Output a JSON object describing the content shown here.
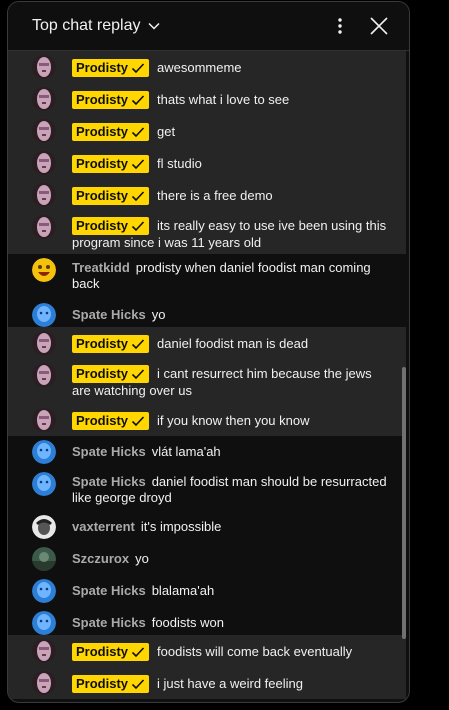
{
  "header": {
    "title": "Top chat replay",
    "menu_icon": "more-vert-icon",
    "close_icon": "close-icon"
  },
  "colors": {
    "background": "#0f0f0f",
    "highlight_row": "#262626",
    "owner_badge": "#ffd600",
    "author_name": "#aaaaaa",
    "message_text": "#f1f1f1"
  },
  "messages": [
    {
      "author": "Prodisty",
      "owner": true,
      "text": "awesommeme"
    },
    {
      "author": "Prodisty",
      "owner": true,
      "text": "thats what i love to see"
    },
    {
      "author": "Prodisty",
      "owner": true,
      "text": "get"
    },
    {
      "author": "Prodisty",
      "owner": true,
      "text": "fl studio"
    },
    {
      "author": "Prodisty",
      "owner": true,
      "text": "there is a free demo"
    },
    {
      "author": "Prodisty",
      "owner": true,
      "text": "its really easy to use ive been using this program since i was 11 years old"
    },
    {
      "author": "Treatkidd",
      "owner": false,
      "text": "prodisty when daniel foodist man coming back"
    },
    {
      "author": "Spate Hicks",
      "owner": false,
      "text": "yo"
    },
    {
      "author": "Prodisty",
      "owner": true,
      "text": "daniel foodist man is dead"
    },
    {
      "author": "Prodisty",
      "owner": true,
      "text": "i cant resurrect him because the jews are watching over us"
    },
    {
      "author": "Prodisty",
      "owner": true,
      "text": "if you know then you know"
    },
    {
      "author": "Spate Hicks",
      "owner": false,
      "text": "vlát lama'ah"
    },
    {
      "author": "Spate Hicks",
      "owner": false,
      "text": "daniel foodist man should be resurracted like george droyd"
    },
    {
      "author": "vaxterrent",
      "owner": false,
      "text": "it's impossible"
    },
    {
      "author": "Szczurox",
      "owner": false,
      "text": "yo"
    },
    {
      "author": "Spate Hicks",
      "owner": false,
      "text": "blalama'ah"
    },
    {
      "author": "Spate Hicks",
      "owner": false,
      "text": "foodists won"
    },
    {
      "author": "Prodisty",
      "owner": true,
      "text": "foodists will come back eventually"
    },
    {
      "author": "Prodisty",
      "owner": true,
      "text": "i just have a weird feeling"
    }
  ]
}
